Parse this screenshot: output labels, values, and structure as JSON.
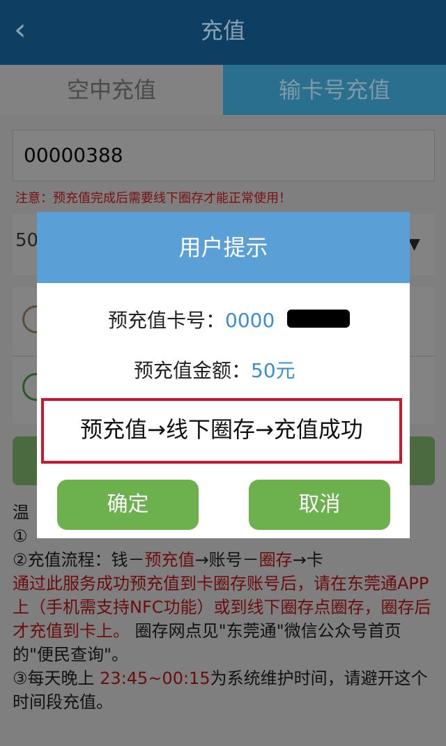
{
  "header": {
    "back_icon": "back-chevron-icon",
    "back_glyph": "‹",
    "title": "充值"
  },
  "tabs": [
    {
      "label": "空中充值"
    },
    {
      "label": "输卡号充值"
    }
  ],
  "card_input": {
    "value": "00000388"
  },
  "notice": "注意：预充值完成后需要线下圈存才能正常使用！",
  "amount_select": {
    "value": "50",
    "arrow": "▼"
  },
  "info": {
    "title": "温",
    "line1": "①",
    "line2_a": "②充值流程：钱－",
    "line2_b": "预充值",
    "line2_c": "→账号－",
    "line2_d": "圈存",
    "line2_e": "→卡",
    "line3_red": "通过此服务成功预充值到卡圈存账号后，请在东莞通APP上（手机需支持NFC功能）或到线下圈存点圈存，圈存后才充值到卡上。",
    "line3_black": "圈存网点见\"东莞通\"微信公众号首页的\"便民查询\"。",
    "line4_a": "③每天晚上 ",
    "line4_b": "23:45~00:15",
    "line4_c": "为系统维护时间，请避开这个时间段充值。"
  },
  "dialog": {
    "title": "用户提示",
    "card_label": "预充值卡号：",
    "card_value": "0000",
    "amount_label": "预充值金额：",
    "amount_value": "50元",
    "flow_text": "预充值→线下圈存→充值成功",
    "confirm": "确定",
    "cancel": "取消"
  },
  "colors": {
    "header": "#0e3f63",
    "dialog_header": "#5b9fd7",
    "button": "#6cb14e",
    "highlight_border": "#d0152c",
    "value_blue": "#3b8fd0"
  }
}
